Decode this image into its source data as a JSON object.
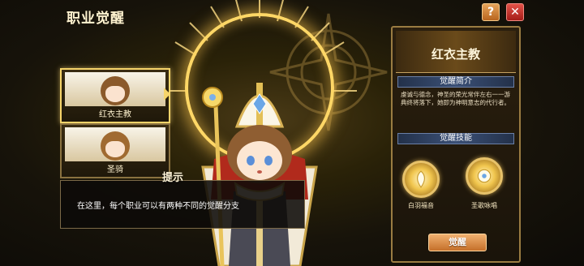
{
  "header": {
    "title": "职业觉醒",
    "help_label": "?",
    "close_label": "✕"
  },
  "classes": [
    {
      "label": "红衣主教",
      "selected": true
    },
    {
      "label": "圣骑",
      "selected": false
    }
  ],
  "tip": {
    "tab_label": "提示",
    "text": "在这里，每个职业可以有两种不同的觉醒分支"
  },
  "panel": {
    "class_name": "红衣主教",
    "intro_header": "觉醒简介",
    "intro_text": "虔诚与德念，神圣的荣光常伴左右一一游典终将落下，她即为神明意志的代行者。",
    "skills_header": "觉醒技能",
    "skills": [
      {
        "label": "白羽福音",
        "icon": "white-feather-icon"
      },
      {
        "label": "圣歌咏唱",
        "icon": "holy-hymn-icon"
      }
    ],
    "awaken_label": "觉醒"
  },
  "colors": {
    "accent_gold": "#f6d46a",
    "close_red": "#d23a30",
    "help_orange": "#d88a3c",
    "section_blue": "#3b5076"
  }
}
